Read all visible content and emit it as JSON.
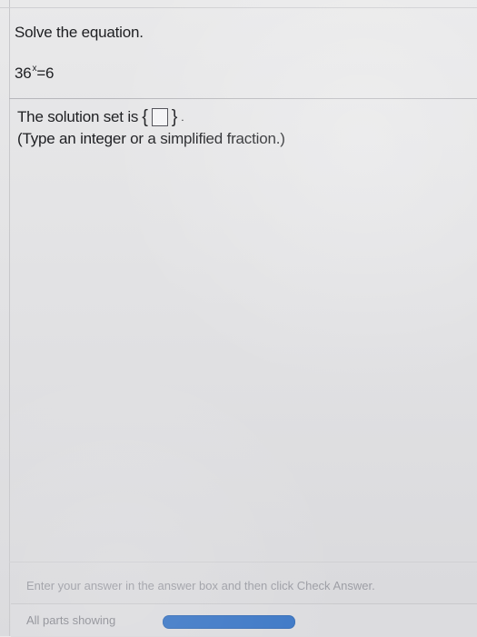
{
  "question": {
    "instruction": "Solve the equation.",
    "equation_base": "36",
    "equation_exponent": "x",
    "equation_rhs": "=6"
  },
  "answer": {
    "prefix": "The solution set is",
    "brace_open": "{",
    "brace_close": "}",
    "period": ".",
    "input_value": "",
    "hint": "(Type an integer or a simplified fraction.)"
  },
  "footer": {
    "instruction": "Enter your answer in the answer box and then click Check Answer.",
    "parts_label": "All parts showing"
  }
}
